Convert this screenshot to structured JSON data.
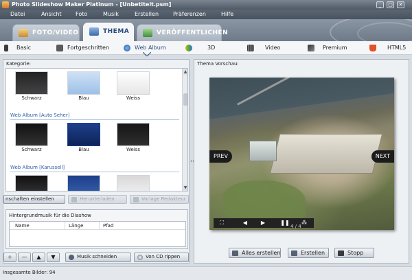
{
  "window": {
    "title": "Photo Slideshow Maker Platinum - [Unbetitelt.psm]",
    "min": "_",
    "max": "▢",
    "close": "✕"
  },
  "menu": [
    "Datei",
    "Ansicht",
    "Foto",
    "Musik",
    "Erstellen",
    "Präferenzen",
    "Hilfe"
  ],
  "main_tabs": [
    {
      "label": "FOTO/VIDEO",
      "active": false
    },
    {
      "label": "THEMA",
      "active": true
    },
    {
      "label": "VERÖFFENTLICHEN",
      "active": false
    }
  ],
  "sub_tabs": [
    {
      "label": "Basic",
      "icon": "basic-icon"
    },
    {
      "label": "Fortgeschritten",
      "icon": "camera-icon"
    },
    {
      "label": "Web Album",
      "icon": "globe-icon",
      "active": true
    },
    {
      "label": "3D",
      "icon": "3d-icon"
    },
    {
      "label": "Video",
      "icon": "film-icon"
    },
    {
      "label": "Premium",
      "icon": "premium-icon"
    },
    {
      "label": "HTML5",
      "icon": "html5-icon"
    }
  ],
  "left": {
    "category_label": "Kategorie:",
    "sections": [
      {
        "title": "",
        "items": [
          "Schwarz",
          "Blau",
          "Weiss"
        ]
      },
      {
        "title": "Web Album [Auto Seher]",
        "items": [
          "Schwarz",
          "Blau",
          "Weiss"
        ]
      },
      {
        "title": "Web Album [Karussell]",
        "items": [
          "",
          "",
          ""
        ]
      }
    ],
    "toolbar": {
      "properties": "nschaften einstellen",
      "download": "Herunterladen",
      "template_editor": "Vorlage Redakteur"
    },
    "music": {
      "label": "Hintergrundmusik für die Diashow",
      "columns": [
        "Name",
        "Länge",
        "Pfad"
      ],
      "cut_music": "Musik schneiden",
      "rip_cd": "Von CD rippen"
    }
  },
  "right": {
    "preview_label": "Thema Vorschau:",
    "prev": "PREV",
    "next": "NEXT",
    "counter": "4 / 4",
    "create_all": "Alles erstellen",
    "create": "Erstellen",
    "stop": "Stopp"
  },
  "status": {
    "text": "Insgesamte Bilder: 94"
  },
  "colors": {
    "accent": "#2b4a7a",
    "section_blue": "#2a5aa8"
  }
}
